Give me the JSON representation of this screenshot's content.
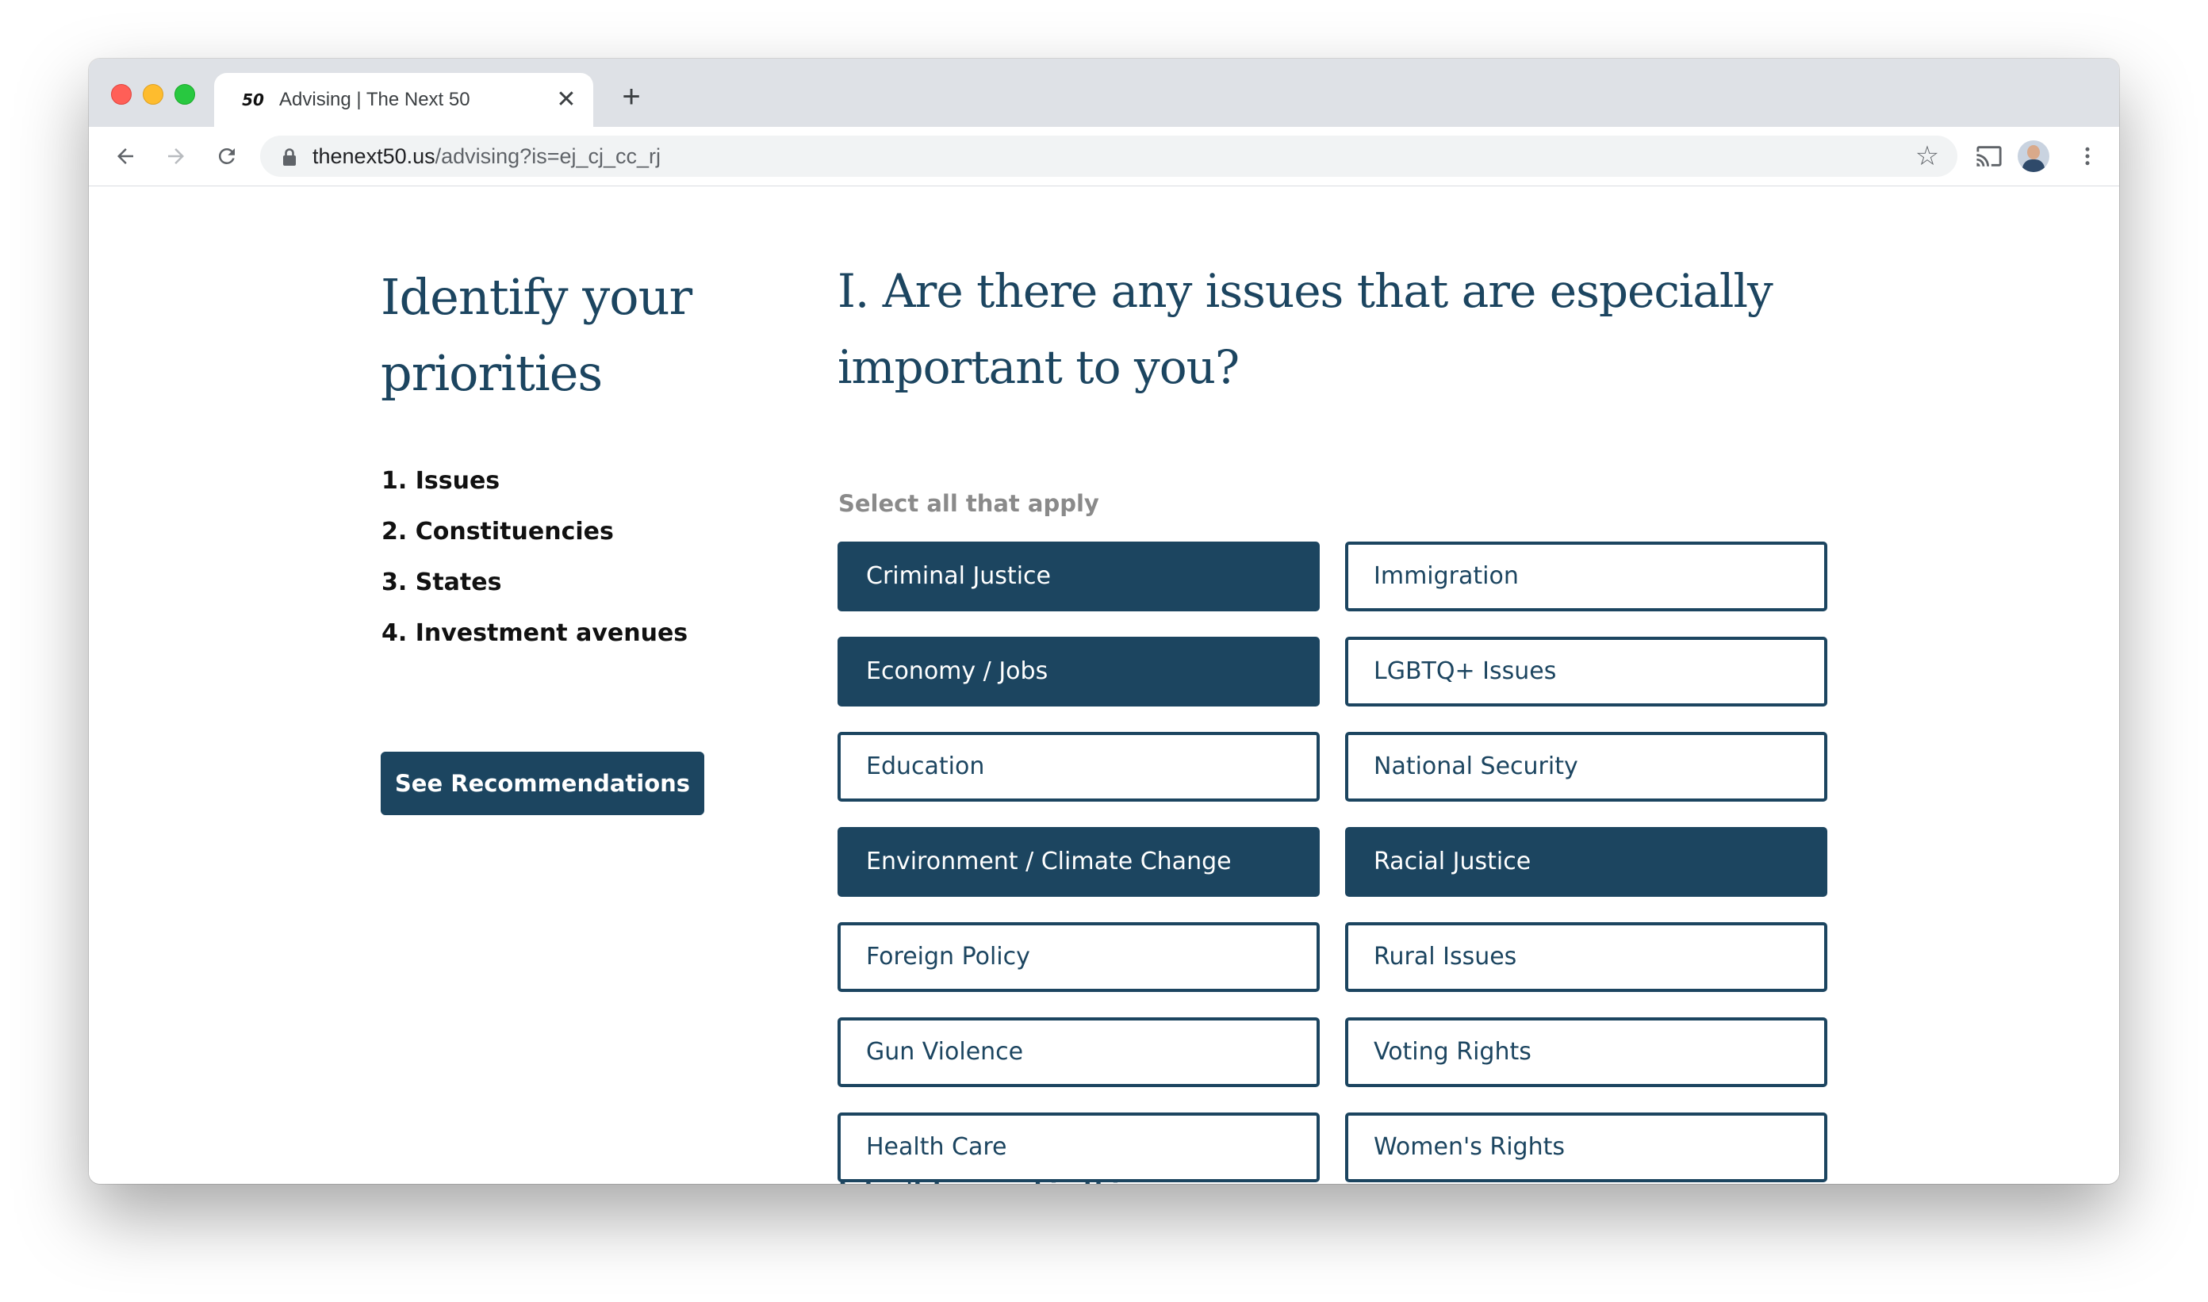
{
  "browser": {
    "tab_title": "Advising | The Next 50",
    "favicon_text": "50",
    "tab_close": "✕",
    "new_tab": "+",
    "url_host": "thenext50.us",
    "url_path": "/advising?is=ej_cj_cc_rj",
    "bookmark_star": "☆"
  },
  "sidebar": {
    "title": "Identify your priorities",
    "steps": [
      "1. Issues",
      "2. Constituencies",
      "3. States",
      "4. Investment avenues"
    ],
    "recommend_label": "See Recommendations"
  },
  "main": {
    "question": "I. Are there any issues that are especially important to you?",
    "hint": "Select all that apply",
    "options": [
      {
        "label": "Criminal Justice",
        "selected": true
      },
      {
        "label": "Immigration",
        "selected": false
      },
      {
        "label": "Economy / Jobs",
        "selected": true
      },
      {
        "label": "LGBTQ+ Issues",
        "selected": false
      },
      {
        "label": "Education",
        "selected": false
      },
      {
        "label": "National Security",
        "selected": false
      },
      {
        "label": "Environment / Climate Change",
        "selected": true
      },
      {
        "label": "Racial Justice",
        "selected": true
      },
      {
        "label": "Foreign Policy",
        "selected": false
      },
      {
        "label": "Rural Issues",
        "selected": false
      },
      {
        "label": "Gun Violence",
        "selected": false
      },
      {
        "label": "Voting Rights",
        "selected": false
      },
      {
        "label": "Health Care",
        "selected": false
      },
      {
        "label": "Women's Rights",
        "selected": false
      }
    ],
    "skip_label": "I don't know, skip this"
  },
  "colors": {
    "brand": "#1c4560",
    "hint": "#8a8a8a"
  }
}
